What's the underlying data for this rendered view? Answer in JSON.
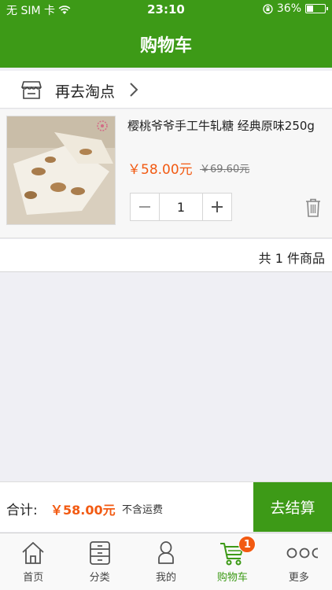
{
  "status_bar": {
    "carrier": "无 SIM 卡",
    "time": "23:10",
    "battery": "36%"
  },
  "header": {
    "title": "购物车"
  },
  "shop": {
    "label": "再去淘点"
  },
  "cart_item": {
    "name": "樱桃爷爷手工牛轧糖 经典原味250g",
    "price": "￥58.00元",
    "original_price": "￥69.60元",
    "quantity": "1"
  },
  "summary": {
    "count_text": "共 1 件商品"
  },
  "checkout": {
    "total_label": "合计:",
    "total_amount": "￥58.00元",
    "shipping_note": "不含运费",
    "button_label": "去结算"
  },
  "tabs": [
    {
      "label": "首页",
      "icon": "home-icon"
    },
    {
      "label": "分类",
      "icon": "category-icon"
    },
    {
      "label": "我的",
      "icon": "profile-icon"
    },
    {
      "label": "购物车",
      "icon": "cart-icon",
      "active": true,
      "badge": "1"
    },
    {
      "label": "更多",
      "icon": "more-icon"
    }
  ],
  "colors": {
    "brand_green": "#3d9a17",
    "price_orange": "#f25a12"
  }
}
